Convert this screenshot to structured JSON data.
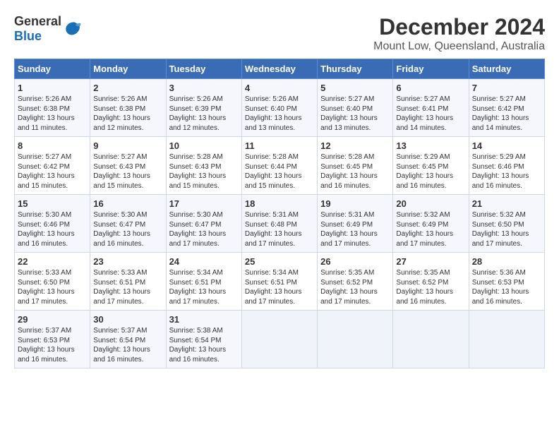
{
  "header": {
    "logo_general": "General",
    "logo_blue": "Blue",
    "month": "December 2024",
    "location": "Mount Low, Queensland, Australia"
  },
  "days_of_week": [
    "Sunday",
    "Monday",
    "Tuesday",
    "Wednesday",
    "Thursday",
    "Friday",
    "Saturday"
  ],
  "weeks": [
    [
      {
        "day": "1",
        "sunrise": "5:26 AM",
        "sunset": "6:38 PM",
        "daylight": "13 hours and 11 minutes."
      },
      {
        "day": "2",
        "sunrise": "5:26 AM",
        "sunset": "6:38 PM",
        "daylight": "13 hours and 12 minutes."
      },
      {
        "day": "3",
        "sunrise": "5:26 AM",
        "sunset": "6:39 PM",
        "daylight": "13 hours and 12 minutes."
      },
      {
        "day": "4",
        "sunrise": "5:26 AM",
        "sunset": "6:40 PM",
        "daylight": "13 hours and 13 minutes."
      },
      {
        "day": "5",
        "sunrise": "5:27 AM",
        "sunset": "6:40 PM",
        "daylight": "13 hours and 13 minutes."
      },
      {
        "day": "6",
        "sunrise": "5:27 AM",
        "sunset": "6:41 PM",
        "daylight": "13 hours and 14 minutes."
      },
      {
        "day": "7",
        "sunrise": "5:27 AM",
        "sunset": "6:42 PM",
        "daylight": "13 hours and 14 minutes."
      }
    ],
    [
      {
        "day": "8",
        "sunrise": "5:27 AM",
        "sunset": "6:42 PM",
        "daylight": "13 hours and 15 minutes."
      },
      {
        "day": "9",
        "sunrise": "5:27 AM",
        "sunset": "6:43 PM",
        "daylight": "13 hours and 15 minutes."
      },
      {
        "day": "10",
        "sunrise": "5:28 AM",
        "sunset": "6:43 PM",
        "daylight": "13 hours and 15 minutes."
      },
      {
        "day": "11",
        "sunrise": "5:28 AM",
        "sunset": "6:44 PM",
        "daylight": "13 hours and 15 minutes."
      },
      {
        "day": "12",
        "sunrise": "5:28 AM",
        "sunset": "6:45 PM",
        "daylight": "13 hours and 16 minutes."
      },
      {
        "day": "13",
        "sunrise": "5:29 AM",
        "sunset": "6:45 PM",
        "daylight": "13 hours and 16 minutes."
      },
      {
        "day": "14",
        "sunrise": "5:29 AM",
        "sunset": "6:46 PM",
        "daylight": "13 hours and 16 minutes."
      }
    ],
    [
      {
        "day": "15",
        "sunrise": "5:30 AM",
        "sunset": "6:46 PM",
        "daylight": "13 hours and 16 minutes."
      },
      {
        "day": "16",
        "sunrise": "5:30 AM",
        "sunset": "6:47 PM",
        "daylight": "13 hours and 16 minutes."
      },
      {
        "day": "17",
        "sunrise": "5:30 AM",
        "sunset": "6:47 PM",
        "daylight": "13 hours and 17 minutes."
      },
      {
        "day": "18",
        "sunrise": "5:31 AM",
        "sunset": "6:48 PM",
        "daylight": "13 hours and 17 minutes."
      },
      {
        "day": "19",
        "sunrise": "5:31 AM",
        "sunset": "6:49 PM",
        "daylight": "13 hours and 17 minutes."
      },
      {
        "day": "20",
        "sunrise": "5:32 AM",
        "sunset": "6:49 PM",
        "daylight": "13 hours and 17 minutes."
      },
      {
        "day": "21",
        "sunrise": "5:32 AM",
        "sunset": "6:50 PM",
        "daylight": "13 hours and 17 minutes."
      }
    ],
    [
      {
        "day": "22",
        "sunrise": "5:33 AM",
        "sunset": "6:50 PM",
        "daylight": "13 hours and 17 minutes."
      },
      {
        "day": "23",
        "sunrise": "5:33 AM",
        "sunset": "6:51 PM",
        "daylight": "13 hours and 17 minutes."
      },
      {
        "day": "24",
        "sunrise": "5:34 AM",
        "sunset": "6:51 PM",
        "daylight": "13 hours and 17 minutes."
      },
      {
        "day": "25",
        "sunrise": "5:34 AM",
        "sunset": "6:51 PM",
        "daylight": "13 hours and 17 minutes."
      },
      {
        "day": "26",
        "sunrise": "5:35 AM",
        "sunset": "6:52 PM",
        "daylight": "13 hours and 17 minutes."
      },
      {
        "day": "27",
        "sunrise": "5:35 AM",
        "sunset": "6:52 PM",
        "daylight": "13 hours and 16 minutes."
      },
      {
        "day": "28",
        "sunrise": "5:36 AM",
        "sunset": "6:53 PM",
        "daylight": "13 hours and 16 minutes."
      }
    ],
    [
      {
        "day": "29",
        "sunrise": "5:37 AM",
        "sunset": "6:53 PM",
        "daylight": "13 hours and 16 minutes."
      },
      {
        "day": "30",
        "sunrise": "5:37 AM",
        "sunset": "6:54 PM",
        "daylight": "13 hours and 16 minutes."
      },
      {
        "day": "31",
        "sunrise": "5:38 AM",
        "sunset": "6:54 PM",
        "daylight": "13 hours and 16 minutes."
      },
      null,
      null,
      null,
      null
    ]
  ]
}
